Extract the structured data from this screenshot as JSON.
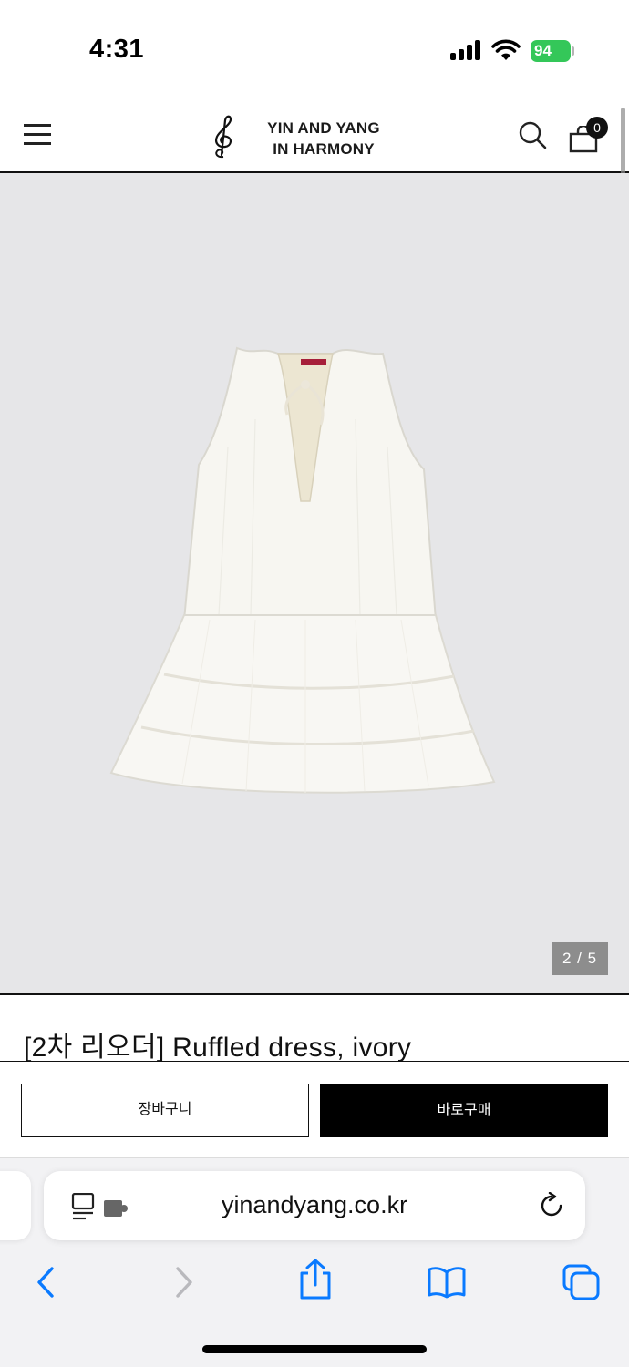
{
  "status_bar": {
    "time": "4:31",
    "battery": "94",
    "icons": [
      "cellular-signal-icon",
      "wifi-icon",
      "battery-charging-icon"
    ]
  },
  "header": {
    "logo_line1": "YIN AND YANG",
    "logo_line2": "IN HARMONY",
    "cart_count": "0",
    "icons": [
      "hamburger-menu-icon",
      "treble-clef-logo",
      "search-icon",
      "shopping-bag-icon"
    ]
  },
  "product": {
    "title": "[2차 리오더] Ruffled dress, ivory",
    "image_subject": "ivory sleeveless ruffled dress",
    "slide_counter": "2 / 5"
  },
  "actions": {
    "cart_label": "장바구니",
    "buy_label": "바로구매"
  },
  "browser": {
    "url": "yinandyang.co.kr",
    "icons": [
      "reader-mode-icon",
      "extension-icon",
      "reload-icon",
      "back-icon",
      "forward-icon",
      "share-icon",
      "bookmarks-icon",
      "tabs-icon"
    ]
  },
  "colors": {
    "image_background": "#e6e6e8",
    "buy_button": "#000000",
    "battery": "#34c759",
    "safari_accent": "#0a7aff"
  }
}
